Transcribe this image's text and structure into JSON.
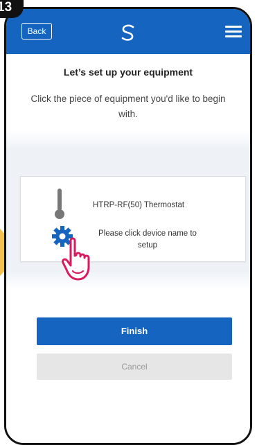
{
  "step": {
    "number": "13"
  },
  "header": {
    "back_label": "Back",
    "logo_icon": "swirl-logo-icon",
    "menu_icon": "hamburger-menu-icon",
    "bar_color": "#1565c0"
  },
  "main": {
    "title": "Let’s set up your equipment",
    "subtitle": "Click the piece of equipment you'd like to begin with.",
    "device": {
      "icon": "thermometer-icon",
      "name": "HTRP-RF(50) Thermostat",
      "settings_icon": "gear-icon",
      "hint": "Please click device name to setup"
    },
    "pointer_icon": "hand-pointer-icon"
  },
  "actions": {
    "finish_label": "Finish",
    "cancel_label": "Cancel"
  },
  "colors": {
    "accent": "#1565c0",
    "highlight_arrow": "#f4c04f",
    "pointer": "#d81b60"
  }
}
